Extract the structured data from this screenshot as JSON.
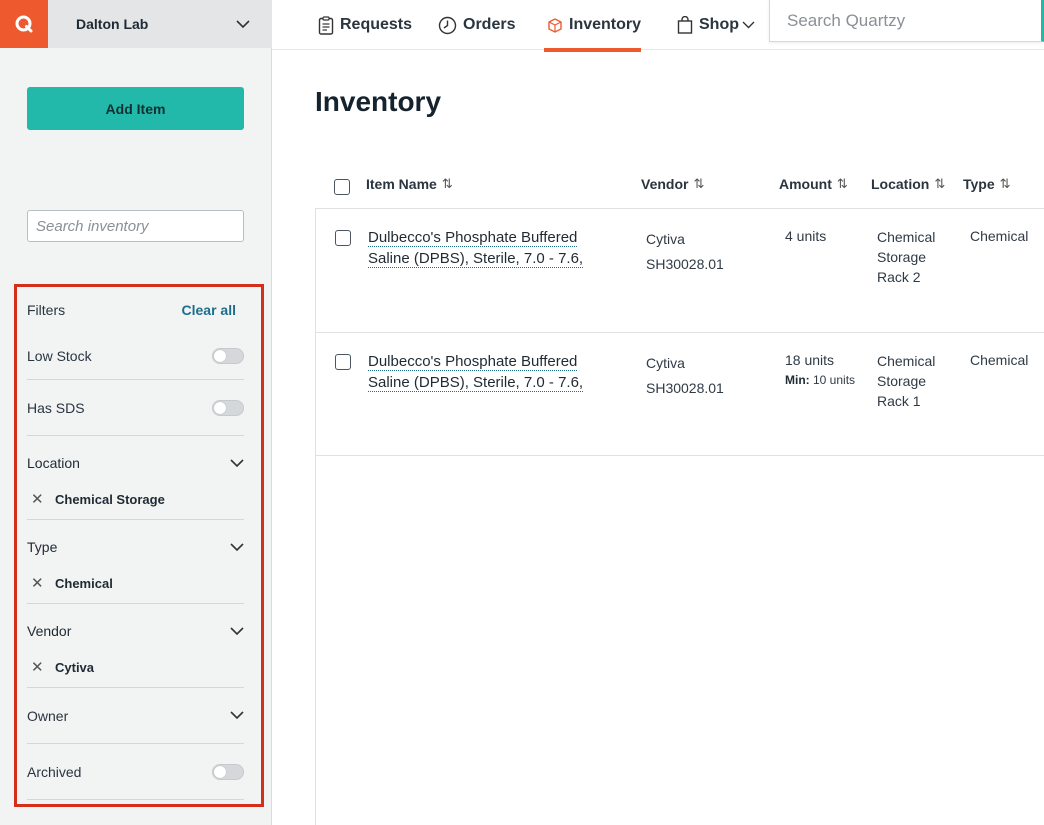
{
  "app": {
    "logo_icon": "quartzy-q-icon",
    "accent": "#ee5a2e",
    "teal": "#22b8aa",
    "highlight": "#d32f1a"
  },
  "workspace": {
    "name": "Dalton Lab"
  },
  "sidebar": {
    "add_item_label": "Add Item",
    "search_placeholder": "Search inventory",
    "filters": {
      "title": "Filters",
      "clear_all": "Clear all",
      "low_stock": "Low Stock",
      "has_sds": "Has SDS",
      "location": {
        "label": "Location",
        "selected": "Chemical Storage"
      },
      "type": {
        "label": "Type",
        "selected": "Chemical"
      },
      "vendor": {
        "label": "Vendor",
        "selected": "Cytiva"
      },
      "owner": {
        "label": "Owner"
      },
      "archived": "Archived"
    }
  },
  "nav": {
    "requests": "Requests",
    "orders": "Orders",
    "inventory": "Inventory",
    "shop": "Shop",
    "search_placeholder": "Search Quartzy"
  },
  "main": {
    "title": "Inventory",
    "columns": {
      "item_name": "Item Name",
      "vendor": "Vendor",
      "amount": "Amount",
      "location": "Location",
      "type": "Type"
    },
    "rows": [
      {
        "name_line1": "Dulbecco's Phosphate Buffered",
        "name_line2": "Saline (DPBS), Sterile, 7.0 - 7.6,",
        "vendor": "Cytiva",
        "catalog": "SH30028.01",
        "amount": "4 units",
        "min_label": "",
        "min_value": "",
        "loc1": "Chemical",
        "loc2": "Storage",
        "loc3": "Rack 2",
        "type": "Chemical"
      },
      {
        "name_line1": "Dulbecco's Phosphate Buffered",
        "name_line2": "Saline (DPBS), Sterile, 7.0 - 7.6,",
        "vendor": "Cytiva",
        "catalog": "SH30028.01",
        "amount": "18 units",
        "min_label": "Min:",
        "min_value": "10 units",
        "loc1": "Chemical",
        "loc2": "Storage",
        "loc3": "Rack 1",
        "type": "Chemical"
      }
    ]
  }
}
